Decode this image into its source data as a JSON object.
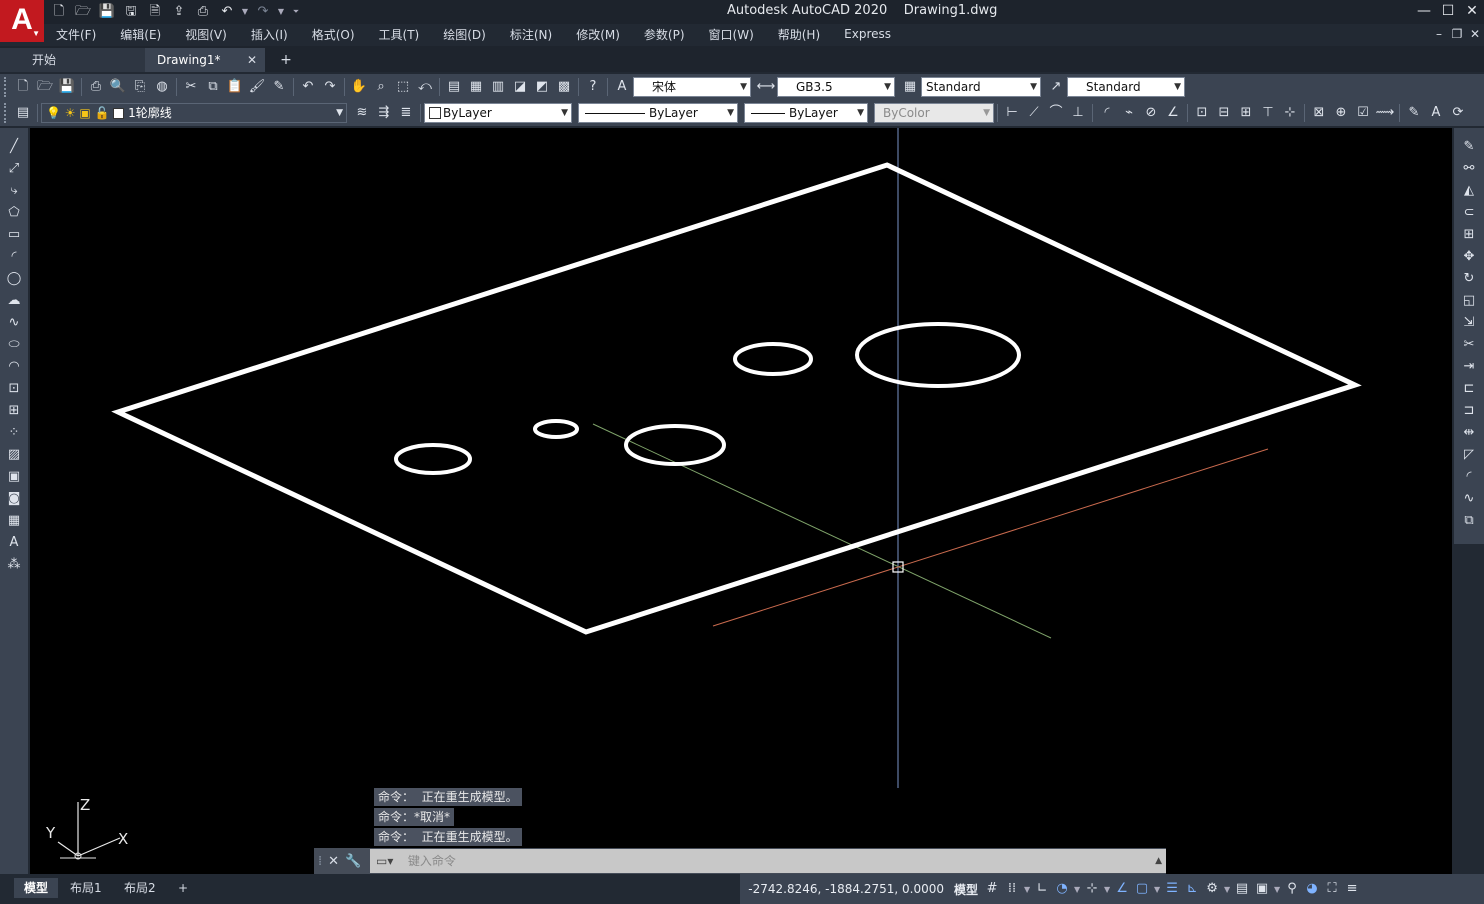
{
  "app": {
    "logo_letter": "A",
    "window_title": "Autodesk AutoCAD 2020    Drawing1.dwg"
  },
  "quick_access": {
    "icons": [
      "new-icon",
      "open-icon",
      "save-icon",
      "save-as-icon",
      "plot-preview-icon",
      "export-icon",
      "print-icon",
      "undo-icon",
      "redo-icon"
    ]
  },
  "menu": {
    "items": [
      "文件(F)",
      "编辑(E)",
      "视图(V)",
      "插入(I)",
      "格式(O)",
      "工具(T)",
      "绘图(D)",
      "标注(N)",
      "修改(M)",
      "参数(P)",
      "窗口(W)",
      "帮助(H)",
      "Express"
    ]
  },
  "tabs": {
    "start": "开始",
    "drawing": "Drawing1*",
    "add": "+"
  },
  "styles_toolbar": {
    "text_style": "宋体",
    "dim_style": "GB3.5",
    "table_style": "Standard",
    "multileader_style": "Standard"
  },
  "properties_toolbar": {
    "layer": "1轮廓线",
    "color": "ByLayer",
    "linetype": "ByLayer",
    "lineweight": "ByLayer",
    "plot_style": "ByColor"
  },
  "command_history": [
    "命令：  正在重生成模型。",
    "命令：*取消*",
    "命令：  正在重生成模型。"
  ],
  "command_line": {
    "placeholder": "键入命令"
  },
  "layout_tabs": [
    "模型",
    "布局1",
    "布局2",
    "+"
  ],
  "status": {
    "coordinates": "-2742.8246, -1884.2751, 0.0000",
    "space": "模型"
  },
  "ucs": {
    "x": "X",
    "y": "Y",
    "z": "Z"
  },
  "colors": {
    "viewport_bg": "#000000",
    "toolbar_bg": "#3b4452",
    "logo_red": "#c2191f",
    "geometry": "#ffffff",
    "x_axis": "#c96a4e",
    "y_axis": "#7fa36a",
    "z_axis": "#7a93c9"
  }
}
